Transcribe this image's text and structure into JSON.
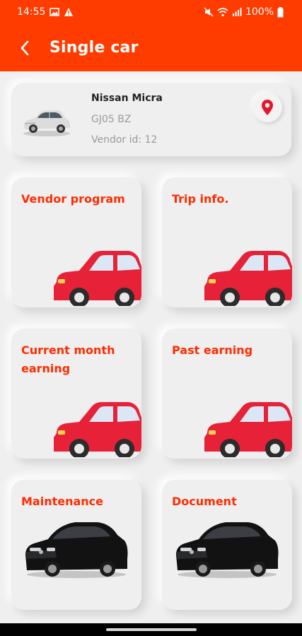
{
  "status": {
    "time": "14:55",
    "battery": "100%"
  },
  "header": {
    "title": "Single car"
  },
  "vehicle": {
    "name": "Nissan Micra",
    "plate": "GJ05 BZ",
    "vendor_id": "Vendor id: 12"
  },
  "tiles": [
    {
      "label": "Vendor program",
      "icon": "red-car-icon"
    },
    {
      "label": "Trip info.",
      "icon": "red-car-icon"
    },
    {
      "label": "Current month earning",
      "icon": "red-car-icon"
    },
    {
      "label": "Past earning",
      "icon": "red-car-icon"
    },
    {
      "label": "Maintenance",
      "icon": "black-sedan-icon"
    },
    {
      "label": "Document",
      "icon": "black-sedan-icon"
    }
  ],
  "colors": {
    "primary": "#ff3c00",
    "tile_text": "#ff2c00",
    "car_red": "#e62138"
  }
}
